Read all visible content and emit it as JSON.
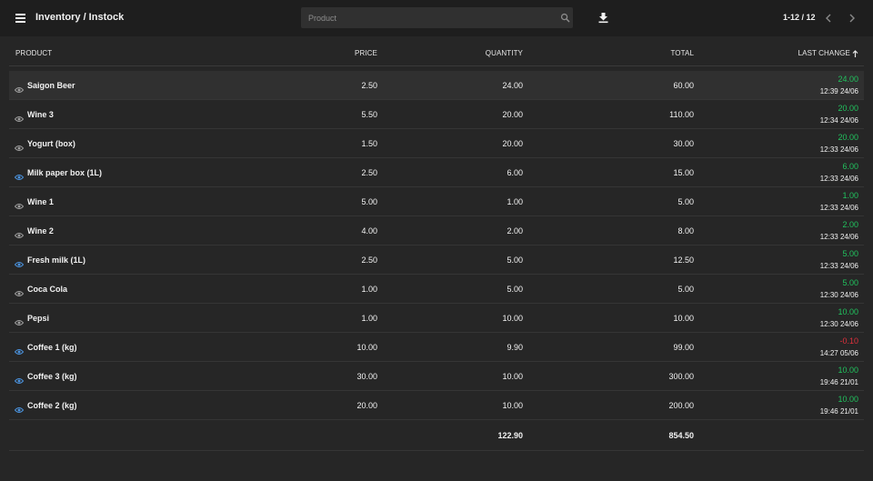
{
  "header": {
    "title": "Inventory / Instock",
    "search_placeholder": "Product",
    "search_value": "",
    "pagination": "1-12 / 12"
  },
  "columns": {
    "product": "PRODUCT",
    "price": "PRICE",
    "quantity": "QUANTITY",
    "total": "TOTAL",
    "last_change": "LAST CHANGE"
  },
  "rows": [
    {
      "product": "Saigon Beer",
      "price": "2.50",
      "quantity": "24.00",
      "total": "60.00",
      "change": "24.00",
      "time": "12:39 24/06",
      "eye": "grey",
      "highlighted": true
    },
    {
      "product": "Wine 3",
      "price": "5.50",
      "quantity": "20.00",
      "total": "110.00",
      "change": "20.00",
      "time": "12:34 24/06",
      "eye": "grey"
    },
    {
      "product": "Yogurt (box)",
      "price": "1.50",
      "quantity": "20.00",
      "total": "30.00",
      "change": "20.00",
      "time": "12:33 24/06",
      "eye": "grey"
    },
    {
      "product": "Milk paper box (1L)",
      "price": "2.50",
      "quantity": "6.00",
      "total": "15.00",
      "change": "6.00",
      "time": "12:33 24/06",
      "eye": "blue"
    },
    {
      "product": "Wine 1",
      "price": "5.00",
      "quantity": "1.00",
      "total": "5.00",
      "change": "1.00",
      "time": "12:33 24/06",
      "eye": "grey"
    },
    {
      "product": "Wine 2",
      "price": "4.00",
      "quantity": "2.00",
      "total": "8.00",
      "change": "2.00",
      "time": "12:33 24/06",
      "eye": "grey"
    },
    {
      "product": "Fresh milk (1L)",
      "price": "2.50",
      "quantity": "5.00",
      "total": "12.50",
      "change": "5.00",
      "time": "12:33 24/06",
      "eye": "blue"
    },
    {
      "product": "Coca Cola",
      "price": "1.00",
      "quantity": "5.00",
      "total": "5.00",
      "change": "5.00",
      "time": "12:30 24/06",
      "eye": "grey"
    },
    {
      "product": "Pepsi",
      "price": "1.00",
      "quantity": "10.00",
      "total": "10.00",
      "change": "10.00",
      "time": "12:30 24/06",
      "eye": "grey"
    },
    {
      "product": "Coffee 1 (kg)",
      "price": "10.00",
      "quantity": "9.90",
      "total": "99.00",
      "change": "-0.10",
      "time": "14:27 05/06",
      "eye": "blue"
    },
    {
      "product": "Coffee 3 (kg)",
      "price": "30.00",
      "quantity": "10.00",
      "total": "300.00",
      "change": "10.00",
      "time": "19:46 21/01",
      "eye": "blue"
    },
    {
      "product": "Coffee 2 (kg)",
      "price": "20.00",
      "quantity": "10.00",
      "total": "200.00",
      "change": "10.00",
      "time": "19:46 21/01",
      "eye": "blue"
    }
  ],
  "totals": {
    "quantity": "122.90",
    "total": "854.50"
  },
  "colors": {
    "background": "#262626",
    "topbar": "#1e1e1e",
    "positive": "#21c25e",
    "negative": "#e0303c",
    "eye_blue": "#4a90d9",
    "eye_grey": "#9a9a9a"
  },
  "icons": {
    "menu": "menu-icon",
    "search": "search-icon",
    "download": "download-icon",
    "prev": "chevron-left-icon",
    "next": "chevron-right-icon",
    "sort": "arrow-up-icon",
    "row": "eye-icon"
  }
}
